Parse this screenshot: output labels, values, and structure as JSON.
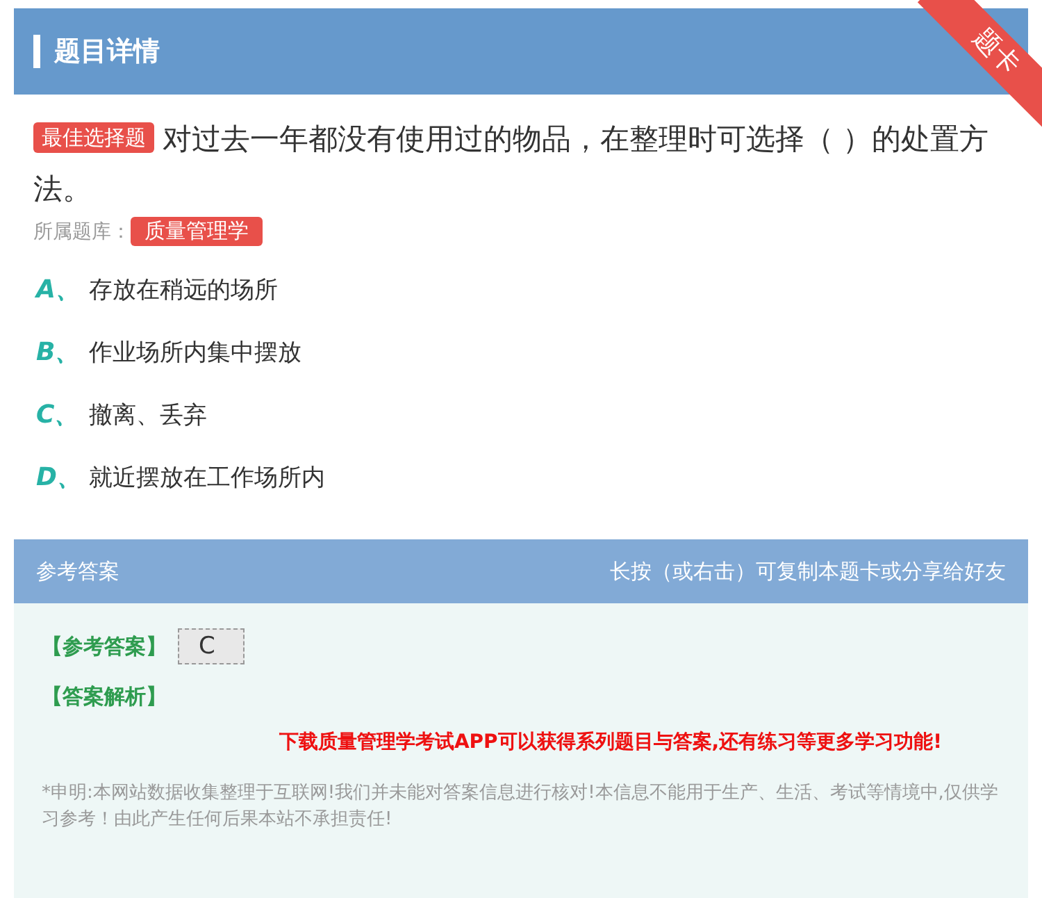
{
  "header": {
    "title": "题目详情",
    "ribbon": "题卡"
  },
  "question": {
    "type_badge": "最佳选择题",
    "text": "对过去一年都没有使用过的物品，在整理时可选择（ ）的处置方法。",
    "bank_label": "所属题库：",
    "bank": "质量管理学"
  },
  "options": [
    {
      "letter": "A、",
      "text": "存放在稍远的场所"
    },
    {
      "letter": "B、",
      "text": "作业场所内集中摆放"
    },
    {
      "letter": "C、",
      "text": "撤离、丢弃"
    },
    {
      "letter": "D、",
      "text": "就近摆放在工作场所内"
    }
  ],
  "answer": {
    "title": "参考答案",
    "hint": "长按（或右击）可复制本题卡或分享给好友",
    "answer_label": "【参考答案】",
    "answer_value": "C",
    "analysis_label": "【答案解析】",
    "promo": "下载质量管理学考试APP可以获得系列题目与答案,还有练习等更多学习功能!",
    "disclaimer": "*申明:本网站数据收集整理于互联网!我们并未能对答案信息进行核对!本信息不能用于生产、生活、考试等情境中,仅供学习参考！由此产生任何后果本站不承担责任!"
  }
}
